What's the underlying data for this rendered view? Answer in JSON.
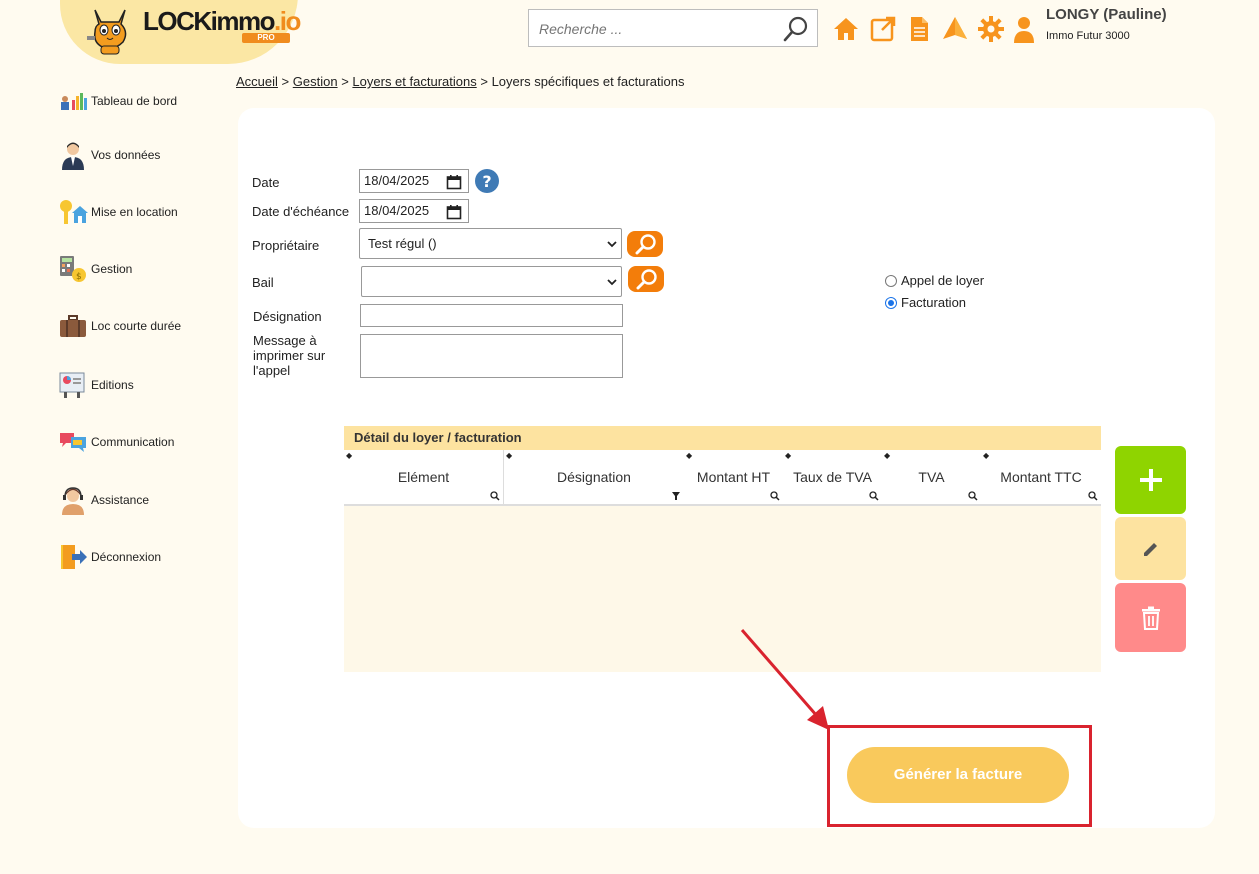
{
  "app": {
    "logo_main": "LOCKimmo",
    "logo_suffix": ".io",
    "logo_badge": "PRO"
  },
  "header": {
    "search_placeholder": "Recherche ...",
    "user_name": "LONGY (Pauline)",
    "user_org": "Immo Futur 3000",
    "icons": [
      "home-icon",
      "external-link-icon",
      "document-icon",
      "alert-triangle-icon",
      "gear-icon",
      "user-icon"
    ],
    "accent_color": "#f7941d"
  },
  "sidebar": {
    "items": [
      {
        "label": "Tableau de bord"
      },
      {
        "label": "Vos données"
      },
      {
        "label": "Mise en location"
      },
      {
        "label": "Gestion"
      },
      {
        "label": "Loc courte durée"
      },
      {
        "label": "Editions"
      },
      {
        "label": "Communication"
      },
      {
        "label": "Assistance"
      },
      {
        "label": "Déconnexion"
      }
    ]
  },
  "breadcrumb": {
    "items": [
      "Accueil",
      "Gestion",
      "Loyers et facturations",
      "Loyers spécifiques et facturations"
    ],
    "separator": ">"
  },
  "form": {
    "date_label": "Date",
    "date_value": "18/04/2025",
    "due_date_label": "Date d'échéance",
    "due_date_value": "18/04/2025",
    "owner_label": "Propriétaire",
    "owner_value": "Test régul ()",
    "lease_label": "Bail",
    "lease_value": "",
    "designation_label": "Désignation",
    "message_label_1": "Message à",
    "message_label_2": "imprimer sur",
    "message_label_3": "l'appel",
    "radio_options": [
      {
        "label": "Appel de loyer",
        "checked": false
      },
      {
        "label": "Facturation",
        "checked": true
      }
    ]
  },
  "grid": {
    "title": "Détail du loyer / facturation",
    "columns": [
      "Elément",
      "Désignation",
      "Montant HT",
      "Taux de TVA",
      "TVA",
      "Montant TTC"
    ],
    "rows": []
  },
  "actions": {
    "add_color": "#8fd400",
    "edit_color": "#fde3a0",
    "delete_color": "#ff8a8a"
  },
  "generate_button": {
    "label": "Générer la facture"
  }
}
